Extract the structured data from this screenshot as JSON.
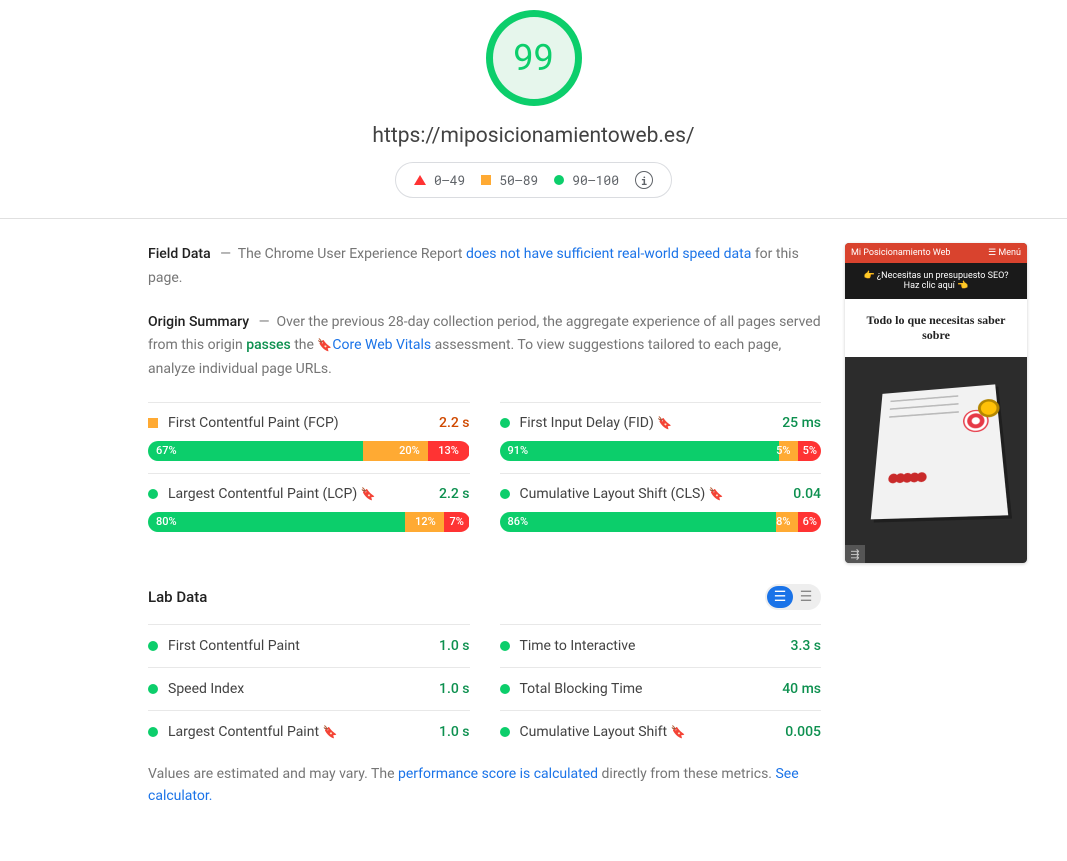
{
  "gauge_score": "99",
  "tested_url": "https://miposicionamientoweb.es/",
  "legend": {
    "poor": "0–49",
    "avg": "50–89",
    "good": "90–100"
  },
  "field_data": {
    "heading": "Field Data",
    "separator": "—",
    "text_1": "The Chrome User Experience Report ",
    "link": "does not have sufficient real-world speed data",
    "text_2": " for this page."
  },
  "origin_summary": {
    "heading": "Origin Summary",
    "separator": "—",
    "text_1": "Over the previous 28-day collection period, the aggregate experience of all pages served from this origin ",
    "passes": "passes",
    "text_2": " the ",
    "cwv_link": "Core Web Vitals",
    "text_3": " assessment. To view suggestions tailored to each page, analyze individual page URLs."
  },
  "metrics": {
    "fcp": {
      "name": "First Contentful Paint (FCP)",
      "value": "2.2 s",
      "good": "67%",
      "avg": "20%",
      "poor": "13%",
      "gw": 67,
      "aw": 20,
      "pw": 13,
      "status": "avg"
    },
    "fid": {
      "name": "First Input Delay (FID)",
      "value": "25 ms",
      "good": "91%",
      "avg": "5%",
      "poor": "5%",
      "gw": 87,
      "aw": 6,
      "pw": 7,
      "status": "good"
    },
    "lcp": {
      "name": "Largest Contentful Paint (LCP)",
      "value": "2.2 s",
      "good": "80%",
      "avg": "12%",
      "poor": "7%",
      "gw": 80,
      "aw": 12,
      "pw": 8,
      "status": "good"
    },
    "cls": {
      "name": "Cumulative Layout Shift (CLS)",
      "value": "0.04",
      "good": "86%",
      "avg": "8%",
      "poor": "6%",
      "gw": 86,
      "aw": 7,
      "pw": 7,
      "status": "good"
    }
  },
  "lab": {
    "heading": "Lab Data",
    "rows": [
      {
        "name": "First Contentful Paint",
        "value": "1.0 s",
        "bookmark": false
      },
      {
        "name": "Time to Interactive",
        "value": "3.3 s",
        "bookmark": false
      },
      {
        "name": "Speed Index",
        "value": "1.0 s",
        "bookmark": false
      },
      {
        "name": "Total Blocking Time",
        "value": "40 ms",
        "bookmark": false
      },
      {
        "name": "Largest Contentful Paint",
        "value": "1.0 s",
        "bookmark": true
      },
      {
        "name": "Cumulative Layout Shift",
        "value": "0.005",
        "bookmark": true
      }
    ],
    "footnote_1": "Values are estimated and may vary. The ",
    "footnote_link1": "performance score is calculated",
    "footnote_2": " directly from these metrics. ",
    "footnote_link2": "See calculator."
  },
  "preview": {
    "brand": "Mi Posicionamiento Web",
    "menu": "☰ Menú",
    "banner": "👉 ¿Necesitas un presupuesto SEO? Haz clic aquí 👈",
    "hero": "Todo lo que necesitas saber sobre"
  }
}
